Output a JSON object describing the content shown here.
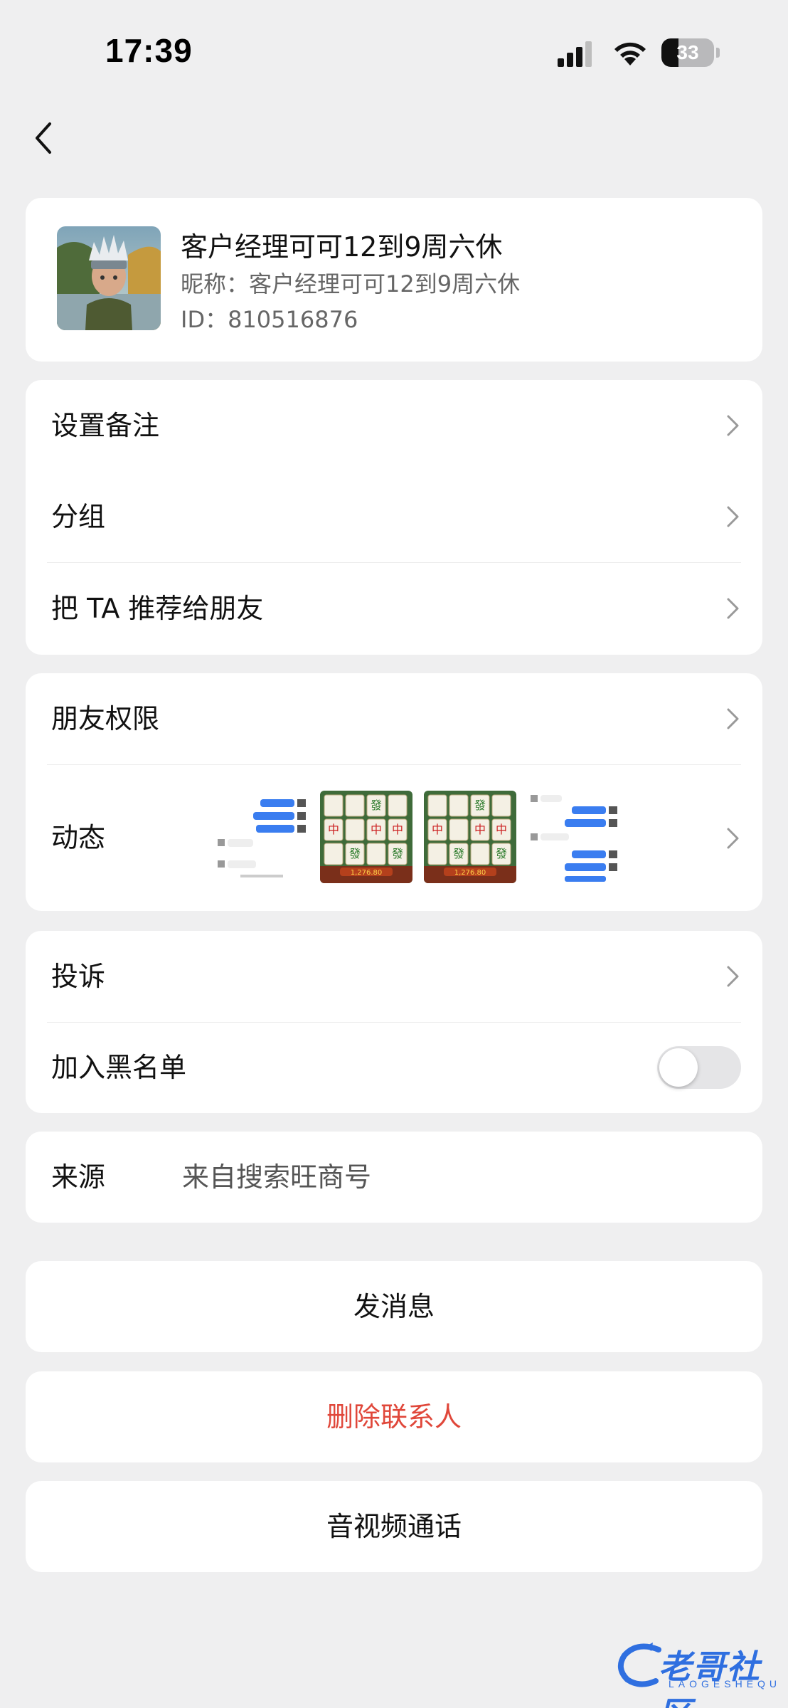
{
  "status_bar": {
    "time": "17:39",
    "battery_percent": "33",
    "battery_level": 0.33,
    "icons": [
      "signal-icon",
      "wifi-icon",
      "battery-icon"
    ]
  },
  "nav": {
    "back_icon": "chevron-left-icon"
  },
  "profile": {
    "name": "客户经理可可12到9周六休",
    "nickname": "昵称：客户经理可可12到9周六休",
    "id": "ID：810516876"
  },
  "settings_group": {
    "remark": "设置备注",
    "group": "分组",
    "recommend": "把 TA 推荐给朋友"
  },
  "privacy_group": {
    "permissions": "朋友权限",
    "moments": "动态",
    "moment_thumbnails": [
      "chat-screenshot",
      "mahjong-game",
      "mahjong-game",
      "chat-screenshot"
    ],
    "mahjong_win_text": "1,276.80"
  },
  "safety_group": {
    "complain": "投诉",
    "blacklist": "加入黑名单",
    "blacklist_enabled": false
  },
  "source": {
    "label": "来源",
    "value": "来自搜索旺商号"
  },
  "actions": {
    "message": "发消息",
    "delete": "删除联系人",
    "call": "音视频通话"
  },
  "colors": {
    "background": "#efeff0",
    "danger": "#e0473a",
    "watermark": "#2f6fe0"
  },
  "watermark": {
    "title": "老哥社区",
    "subtitle": "LAOGESHEQU"
  }
}
